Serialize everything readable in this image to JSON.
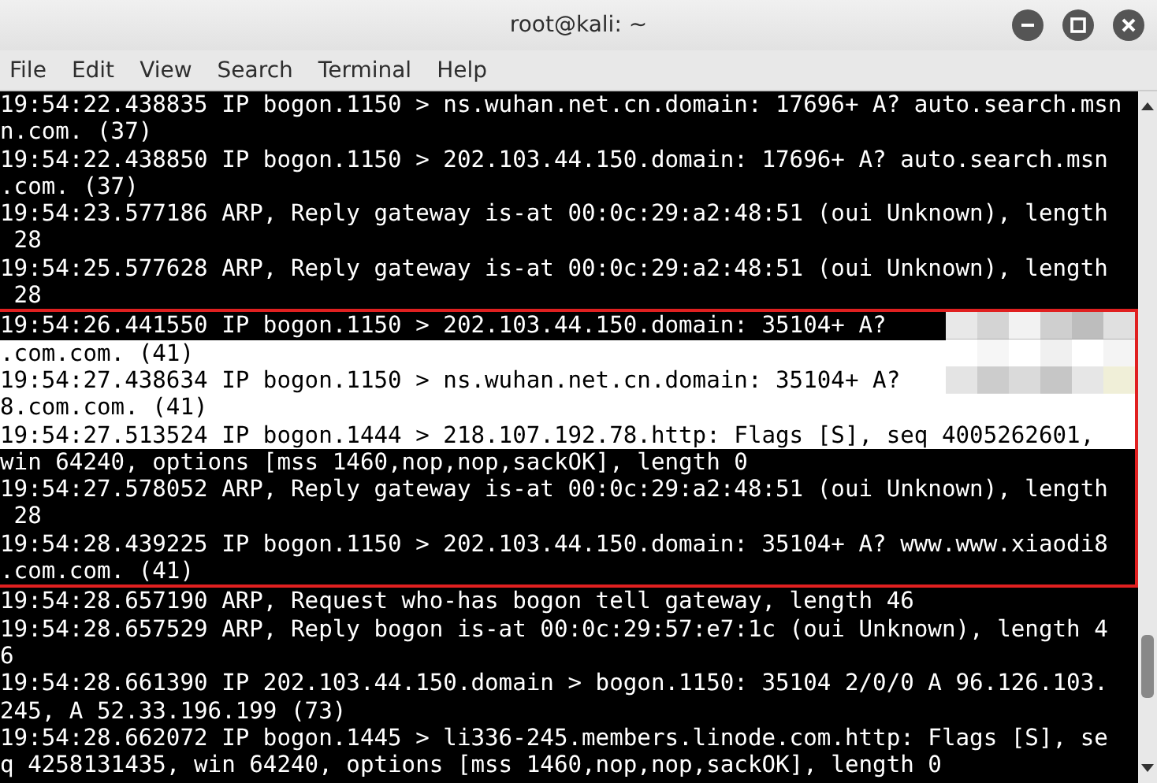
{
  "window": {
    "title": "root@kali: ~"
  },
  "menu": [
    "File",
    "Edit",
    "View",
    "Search",
    "Terminal",
    "Help"
  ],
  "blocks": [
    {
      "framed": false,
      "lines": [
        {
          "text": "19:54:22.438835 IP bogon.1150 > ns.wuhan.net.cn.domain: 17696+ A? auto.search.msn",
          "selected": false
        },
        {
          "text": "n.com. (37)",
          "selected": false
        },
        {
          "text": "19:54:22.438850 IP bogon.1150 > 202.103.44.150.domain: 17696+ A? auto.search.msn",
          "selected": false
        },
        {
          "text": ".com. (37)",
          "selected": false
        },
        {
          "text": "19:54:23.577186 ARP, Reply gateway is-at 00:0c:29:a2:48:51 (oui Unknown), length",
          "selected": false
        },
        {
          "text": " 28",
          "selected": false
        },
        {
          "text": "19:54:25.577628 ARP, Reply gateway is-at 00:0c:29:a2:48:51 (oui Unknown), length",
          "selected": false
        },
        {
          "text": " 28",
          "selected": false
        }
      ]
    },
    {
      "framed": true,
      "lines": [
        {
          "text": "19:54:26.441550 IP bogon.1150 > 202.103.44.150.domain: 35104+ A?",
          "selected": false
        },
        {
          "text": ".com.com. (41)",
          "selected": true
        },
        {
          "text": "19:54:27.438634 IP bogon.1150 > ns.wuhan.net.cn.domain: 35104+ A?",
          "selected": true
        },
        {
          "text": "8.com.com. (41)",
          "selected": true
        },
        {
          "text": "19:54:27.513524 IP bogon.1444 > 218.107.192.78.http: Flags [S], seq 4005262601,",
          "selected": true
        },
        {
          "text": "win 64240, options [mss 1460,nop,nop,sackOK], length 0",
          "selected": false
        },
        {
          "text": "19:54:27.578052 ARP, Reply gateway is-at 00:0c:29:a2:48:51 (oui Unknown), length",
          "selected": false
        },
        {
          "text": " 28",
          "selected": false
        },
        {
          "text": "19:54:28.439225 IP bogon.1150 > 202.103.44.150.domain: 35104+ A? www.www.xiaodi8",
          "selected": false
        },
        {
          "text": ".com.com. (41)",
          "selected": false
        }
      ]
    },
    {
      "framed": false,
      "lines": [
        {
          "text": "19:54:28.657190 ARP, Request who-has bogon tell gateway, length 46",
          "selected": false
        },
        {
          "text": "19:54:28.657529 ARP, Reply bogon is-at 00:0c:29:57:e7:1c (oui Unknown), length 4",
          "selected": false
        },
        {
          "text": "6",
          "selected": false
        },
        {
          "text": "19:54:28.661390 IP 202.103.44.150.domain > bogon.1150: 35104 2/0/0 A 96.126.103.",
          "selected": false
        },
        {
          "text": "245, A 52.33.196.199 (73)",
          "selected": false
        },
        {
          "text": "19:54:28.662072 IP bogon.1445 > li336-245.members.linode.com.http: Flags [S], se",
          "selected": false
        },
        {
          "text": "q 4258131435, win 64240, options [mss 1460,nop,nop,sackOK], length 0",
          "selected": false
        }
      ]
    }
  ]
}
